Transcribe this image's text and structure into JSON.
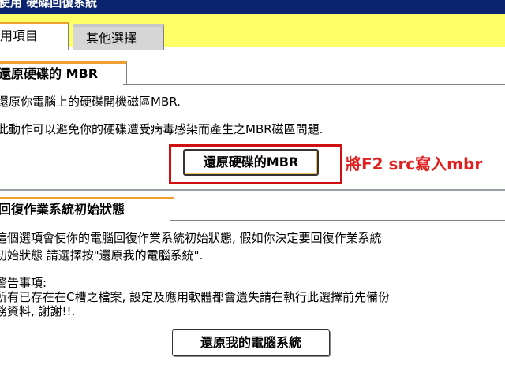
{
  "window": {
    "title": "使用 硬碟回復系統"
  },
  "tabs": [
    {
      "label": "用項目"
    },
    {
      "label": "其他選擇"
    }
  ],
  "mbr_section": {
    "header": "還原硬碟的 MBR",
    "line1": "還原你電腦上的硬碟開機磁區MBR.",
    "line2": "此動作可以避免你的硬碟遭受病毒感染而產生之MBR磁區問題.",
    "button_label": "還原硬碟的MBR"
  },
  "annotation": {
    "text": "將F2 src寫入mbr",
    "color": "#e02020"
  },
  "os_section": {
    "header": "回復作業系統初始狀態",
    "line1": "這個選項會使你的電腦回復作業系統初始狀態, 假如你決定要回復作業系統",
    "line2": "初始狀態 請選擇按\"還原我的電腦系統\".",
    "warning_title": "警告事項:",
    "warning_line1": "所有已存在在C槽之檔案, 設定及應用軟體都會遺失請在執行此選擇前先備份",
    "warning_line2": "務資料, 謝謝!!.",
    "button_label": "還原我的電腦系統"
  },
  "colors": {
    "title_bar": "#0a2470",
    "tab_bar": "#ffff66",
    "accent": "#f0a030",
    "highlight": "#d01010"
  }
}
